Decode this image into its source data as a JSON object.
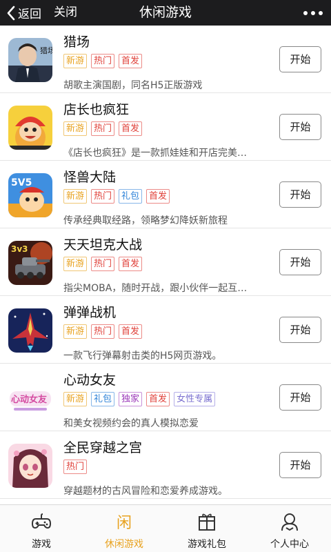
{
  "topbar": {
    "back_label": "返回",
    "close_label": "关闭",
    "title": "休闲游戏"
  },
  "start_label": "开始",
  "games": [
    {
      "name": "猎场",
      "tags": [
        {
          "text": "新游",
          "kind": "new"
        },
        {
          "text": "热门",
          "kind": "hot"
        },
        {
          "text": "首发",
          "kind": "first"
        }
      ],
      "desc": "胡歌主演国剧，同名H5正版游戏",
      "icon": "game-icon-lie-chang",
      "icon_text": "猎场"
    },
    {
      "name": "店长也疯狂",
      "tags": [
        {
          "text": "新游",
          "kind": "new"
        },
        {
          "text": "热门",
          "kind": "hot"
        },
        {
          "text": "首发",
          "kind": "first"
        }
      ],
      "desc": "《店长也疯狂》是一款抓娃娃和开店完美…",
      "icon": "game-icon-dian-zhang"
    },
    {
      "name": "怪兽大陆",
      "tags": [
        {
          "text": "新游",
          "kind": "new"
        },
        {
          "text": "热门",
          "kind": "hot"
        },
        {
          "text": "礼包",
          "kind": "gift"
        },
        {
          "text": "首发",
          "kind": "first"
        }
      ],
      "desc": "传承经典取经路，领略梦幻降妖新旅程",
      "icon": "game-icon-guai-shou",
      "icon_text": "5V5"
    },
    {
      "name": "天天坦克大战",
      "tags": [
        {
          "text": "新游",
          "kind": "new"
        },
        {
          "text": "热门",
          "kind": "hot"
        },
        {
          "text": "首发",
          "kind": "first"
        }
      ],
      "desc": "指尖MOBA，随时开战，跟小伙伴一起互…",
      "icon": "game-icon-tan-ke",
      "icon_text": "3v3"
    },
    {
      "name": "弹弹战机",
      "tags": [
        {
          "text": "新游",
          "kind": "new"
        },
        {
          "text": "热门",
          "kind": "hot"
        },
        {
          "text": "首发",
          "kind": "first"
        }
      ],
      "desc": "一款飞行弹幕射击类的H5网页游戏。",
      "icon": "game-icon-zhan-ji"
    },
    {
      "name": "心动女友",
      "tags": [
        {
          "text": "新游",
          "kind": "new"
        },
        {
          "text": "礼包",
          "kind": "gift"
        },
        {
          "text": "独家",
          "kind": "excl"
        },
        {
          "text": "首发",
          "kind": "first"
        },
        {
          "text": "女性专属",
          "kind": "female"
        }
      ],
      "desc": "和美女视频约会的真人模拟恋爱",
      "icon": "game-icon-xin-dong",
      "icon_text": "心动女友"
    },
    {
      "name": "全民穿越之宫",
      "tags": [
        {
          "text": "热门",
          "kind": "hot"
        }
      ],
      "desc": "穿越题材的古风冒险和恋爱养成游戏。",
      "icon": "game-icon-chuan-yue"
    }
  ],
  "tabs": [
    {
      "label": "游戏",
      "icon": "gamepad-icon",
      "active": false
    },
    {
      "label": "休闲游戏",
      "icon": "casual-icon",
      "active": true,
      "icon_text": "闲"
    },
    {
      "label": "游戏礼包",
      "icon": "gift-box-icon",
      "active": false
    },
    {
      "label": "个人中心",
      "icon": "user-icon",
      "active": false
    }
  ],
  "colors": {
    "topbar": "#1c1c1e",
    "accent": "#e8a21f",
    "hot": "#e0413a",
    "gift": "#2f83d8"
  }
}
